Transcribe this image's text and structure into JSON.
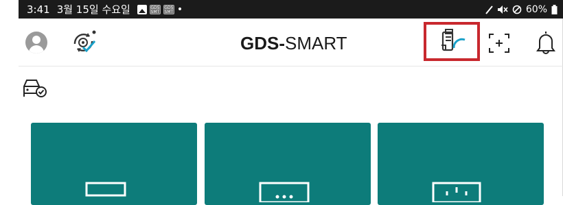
{
  "status_bar": {
    "time": "3:41",
    "date": "3월 15일 수요일",
    "notif_icons": [
      "image-icon",
      "gds-smart-icon",
      "gds-smart-icon"
    ],
    "dot": "•",
    "battery": "60%",
    "right_icons": [
      "stylus-icon",
      "mute-icon",
      "dnd-icon",
      "battery-icon"
    ]
  },
  "app_bar": {
    "logo_bold": "GDS-",
    "logo_light": "SMART",
    "actions": [
      "avatar",
      "sync-settings-icon",
      "vci-gauge-icon",
      "scan-icon",
      "bell-icon"
    ],
    "highlight_color": "#c8282e"
  },
  "section_icon": "car-check-icon",
  "tiles": [
    {
      "icon": "tile-1-icon",
      "color": "#0d7c7a"
    },
    {
      "icon": "tile-2-icon",
      "color": "#0d7c7a"
    },
    {
      "icon": "tile-3-icon",
      "color": "#0d7c7a"
    }
  ],
  "accent_color": "#1aa0c8"
}
